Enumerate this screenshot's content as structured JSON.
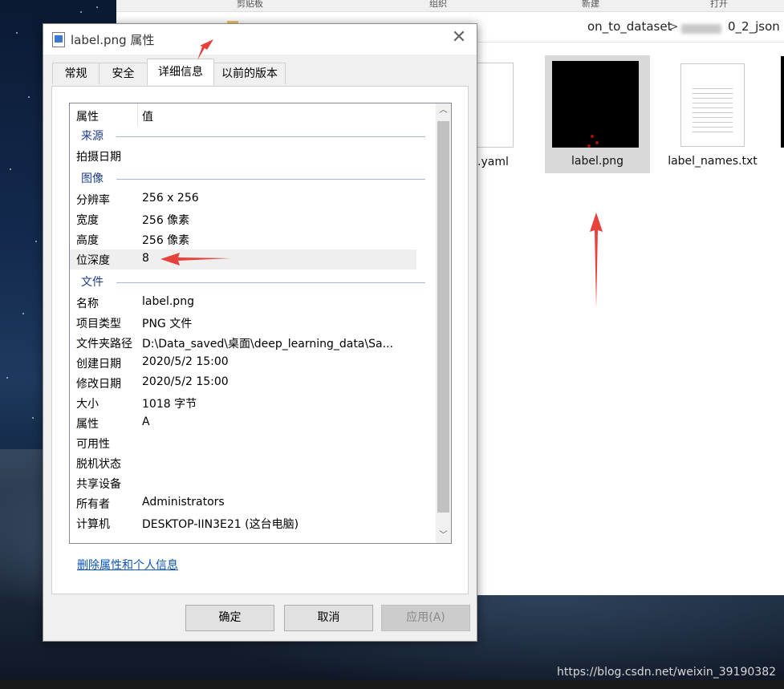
{
  "explorer": {
    "topbar_items": [
      "剪贴板",
      "组织",
      "新建",
      "打开"
    ],
    "address": {
      "visible_text": "on_to_dataset",
      "separator": ">",
      "tail": "0_2_json"
    },
    "files": [
      {
        "name": ".yaml",
        "icon": "document-icon"
      },
      {
        "name": "label.png",
        "icon": "image-thumbnail",
        "selected": true
      },
      {
        "name": "label_names.txt",
        "icon": "text-document-icon"
      }
    ]
  },
  "dialog": {
    "title": "label.png 属性",
    "close_glyph": "✕",
    "tabs": [
      {
        "label": "常规"
      },
      {
        "label": "安全"
      },
      {
        "label": "详细信息",
        "active": true
      },
      {
        "label": "以前的版本"
      }
    ],
    "header": {
      "col1": "属性",
      "col2": "值"
    },
    "groups": {
      "source": "来源",
      "image": "图像",
      "file": "文件"
    },
    "rows": {
      "date_taken": {
        "k": "拍摄日期",
        "v": ""
      },
      "resolution": {
        "k": "分辨率",
        "v": "256 x 256"
      },
      "width": {
        "k": "宽度",
        "v": "256 像素"
      },
      "height": {
        "k": "高度",
        "v": "256 像素"
      },
      "bit_depth": {
        "k": "位深度",
        "v": "8"
      },
      "name": {
        "k": "名称",
        "v": "label.png"
      },
      "item_type": {
        "k": "项目类型",
        "v": "PNG 文件"
      },
      "folder_path": {
        "k": "文件夹路径",
        "v": "D:\\Data_saved\\桌面\\deep_learning_data\\Sa..."
      },
      "created": {
        "k": "创建日期",
        "v": "2020/5/2 15:00"
      },
      "modified": {
        "k": "修改日期",
        "v": "2020/5/2 15:00"
      },
      "size": {
        "k": "大小",
        "v": "1018 字节"
      },
      "attributes": {
        "k": "属性",
        "v": "A"
      },
      "availability": {
        "k": "可用性",
        "v": ""
      },
      "offline_status": {
        "k": "脱机状态",
        "v": ""
      },
      "shared_with": {
        "k": "共享设备",
        "v": ""
      },
      "owner": {
        "k": "所有者",
        "v": "Administrators"
      },
      "computer": {
        "k": "计算机",
        "v": "DESKTOP-IIN3E21 (这台电脑)"
      }
    },
    "remove_link": "删除属性和个人信息",
    "buttons": {
      "ok": "确定",
      "cancel": "取消",
      "apply": "应用(A)"
    }
  },
  "watermark": "https://blog.csdn.net/weixin_39190382",
  "colors": {
    "arrow": "#e8403a",
    "link": "#0a54b5",
    "group": "#1e3c8c"
  }
}
